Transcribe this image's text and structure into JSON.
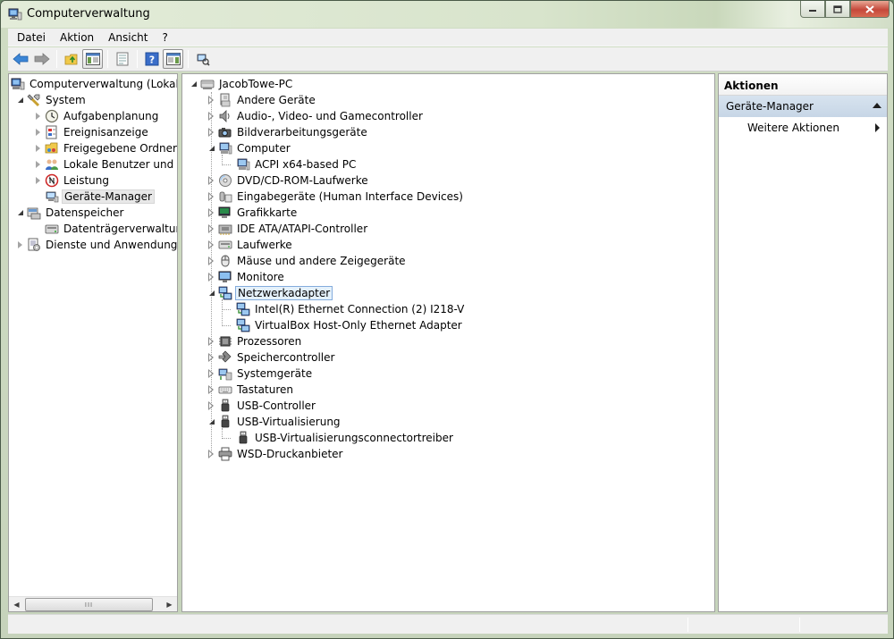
{
  "window": {
    "title": "Computerverwaltung"
  },
  "menubar": [
    "Datei",
    "Aktion",
    "Ansicht",
    "?"
  ],
  "toolbar": [
    "back-icon",
    "forward-icon",
    "up-folder-icon",
    "show-hide-tree-icon",
    "export-list-icon",
    "help-icon",
    "show-hide-action-pane-icon",
    "scan-hardware-icon"
  ],
  "left_tree": {
    "root": "Computerverwaltung (Lokal)",
    "system": "System",
    "system_items": [
      "Aufgabenplanung",
      "Ereignisanzeige",
      "Freigegebene Ordner",
      "Lokale Benutzer und Gruppen",
      "Leistung",
      "Geräte-Manager"
    ],
    "storage": "Datenspeicher",
    "storage_items": [
      "Datenträgerverwaltung"
    ],
    "services": "Dienste und Anwendungen"
  },
  "device_tree": {
    "root": "JacobTowe-PC",
    "categories": [
      "Andere Geräte",
      "Audio-, Video- und Gamecontroller",
      "Bildverarbeitungsgeräte",
      "Computer",
      "DVD/CD-ROM-Laufwerke",
      "Eingabegeräte (Human Interface Devices)",
      "Grafikkarte",
      "IDE ATA/ATAPI-Controller",
      "Laufwerke",
      "Mäuse und andere Zeigegeräte",
      "Monitore",
      "Netzwerkadapter",
      "Prozessoren",
      "Speichercontroller",
      "Systemgeräte",
      "Tastaturen",
      "USB-Controller",
      "USB-Virtualisierung",
      "WSD-Druckanbieter"
    ],
    "computer_children": [
      "ACPI x64-based PC"
    ],
    "network_children": [
      "Intel(R) Ethernet Connection (2) I218-V",
      "VirtualBox Host-Only Ethernet Adapter"
    ],
    "usbvirt_children": [
      "USB-Virtualisierungsconnectortreiber"
    ]
  },
  "actions": {
    "header": "Aktionen",
    "group": "Geräte-Manager",
    "item": "Weitere Aktionen"
  },
  "scrollbar": {
    "grip": "III"
  }
}
